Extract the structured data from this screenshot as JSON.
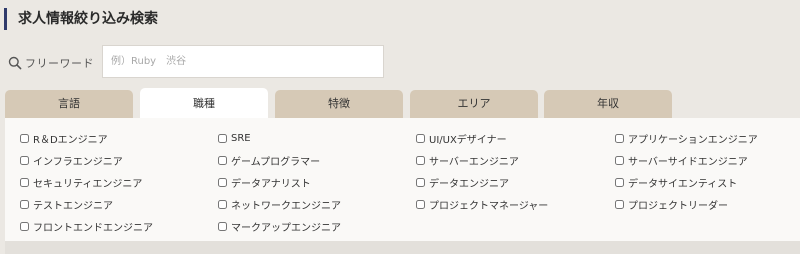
{
  "title": "求人情報絞り込み検索",
  "freeword": {
    "label": "フリーワード",
    "placeholder": "例）Ruby　渋谷",
    "value": ""
  },
  "tabs": [
    {
      "label": "言語",
      "active": false
    },
    {
      "label": "職種",
      "active": true
    },
    {
      "label": "特徴",
      "active": false
    },
    {
      "label": "エリア",
      "active": false
    },
    {
      "label": "年収",
      "active": false
    }
  ],
  "job_types": {
    "columns": [
      [
        "R＆Dエンジニア",
        "インフラエンジニア",
        "セキュリティエンジニア",
        "テストエンジニア",
        "フロントエンドエンジニア"
      ],
      [
        "SRE",
        "ゲームプログラマー",
        "データアナリスト",
        "ネットワークエンジニア",
        "マークアップエンジニア"
      ],
      [
        "UI/UXデザイナー",
        "サーバーエンジニア",
        "データエンジニア",
        "プロジェクトマネージャー"
      ],
      [
        "アプリケーションエンジニア",
        "サーバーサイドエンジニア",
        "データサイエンティスト",
        "プロジェクトリーダー"
      ]
    ]
  },
  "colors": {
    "accent_bar": "#2f3a6b",
    "tab_inactive": "#d6c9b6",
    "tab_active": "#ffffff",
    "background": "#ebe8e3"
  },
  "icons": {
    "freeword": "search-icon"
  }
}
